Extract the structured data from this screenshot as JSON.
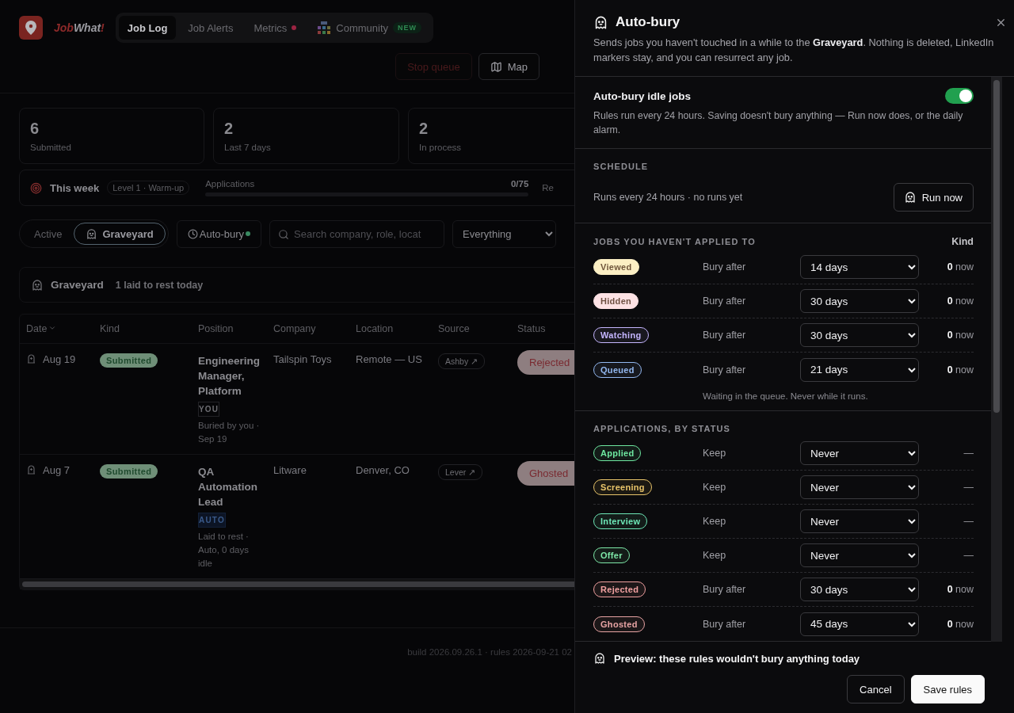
{
  "brand": {
    "parts": [
      {
        "text": "Job",
        "accent": true
      },
      {
        "text": "What",
        "accent": false
      },
      {
        "text": "!",
        "accent": true
      }
    ]
  },
  "nav_tabs": [
    {
      "label": "Job Log",
      "selected": true,
      "dot": false,
      "has_icon": false
    },
    {
      "label": "Job Alerts",
      "selected": false,
      "dot": false,
      "has_icon": false
    },
    {
      "label": "Metrics",
      "selected": false,
      "dot": true,
      "has_icon": false
    },
    {
      "label": "Community",
      "selected": false,
      "dot": false,
      "has_icon": true,
      "badge": "NEW"
    }
  ],
  "toolbar_buttons": [
    {
      "label": "Stop queue",
      "kind": "danger"
    },
    {
      "label": "Map",
      "kind": "map"
    }
  ],
  "stats": [
    {
      "value": "6",
      "label": "Submitted"
    },
    {
      "value": "2",
      "label": "Last 7 days"
    },
    {
      "value": "2",
      "label": "In process"
    }
  ],
  "week": {
    "title": "This week",
    "level_badge": "Level 1 · Warm-up",
    "meter": {
      "label": "Applications",
      "reading": "0/75",
      "level": 0
    },
    "next_label": "Re"
  },
  "filters": {
    "view_tabs": [
      {
        "label": "Active",
        "selected": false
      },
      {
        "label": "Graveyard",
        "selected": true
      }
    ],
    "autobury": {
      "label": "Auto-bury",
      "on": true
    },
    "search": {
      "placeholder": "Search company, role, locat"
    },
    "select": {
      "value": "Everything"
    }
  },
  "graveyard": {
    "title": "Graveyard",
    "subtitle": "1 laid to rest today"
  },
  "table": {
    "columns": [
      {
        "label": "Date",
        "sorted": true
      },
      {
        "label": "Kind",
        "sorted": false
      },
      {
        "label": "Position",
        "sorted": false
      },
      {
        "label": "Company",
        "sorted": false
      },
      {
        "label": "Location",
        "sorted": false
      },
      {
        "label": "Source",
        "sorted": false
      },
      {
        "label": "Status",
        "sorted": false
      }
    ],
    "rows": [
      {
        "date": "Aug 19",
        "kind": "Submitted",
        "position": "Engineering Manager, Platform",
        "tag": {
          "label": "YOU",
          "kind": "you"
        },
        "note": "Buried by you · Sep 19",
        "company": "Tailspin Toys",
        "location": "Remote — US",
        "source": "Ashby ↗",
        "status": "Rejected"
      },
      {
        "date": "Aug 7",
        "kind": "Submitted",
        "position": "QA Automation Lead",
        "tag": {
          "label": "AUTO",
          "kind": "auto"
        },
        "note": "Laid to rest · Auto, 0 days idle",
        "company": "Litware",
        "location": "Denver, CO",
        "source": "Lever ↗",
        "status": "Ghosted"
      }
    ]
  },
  "footer": "build 2026.09.26.1 · rules 2026-09-21 02",
  "drawer": {
    "title": "Auto-bury",
    "description": "Sends jobs you haven't touched in a while to the **Graveyard**. Nothing is deleted, LinkedIn markers stay, and you can resurrect any job.",
    "toggle": {
      "label": "Auto-bury idle jobs",
      "on": true,
      "hint": "Rules run every 24 hours. Saving doesn't bury anything — Run now does, or the daily alarm."
    },
    "schedule": {
      "heading": "SCHEDULE",
      "text": "Runs every 24 hours · no runs yet",
      "button": "Run now"
    },
    "sections": [
      {
        "heading": "JOBS YOU HAVEN'T APPLIED TO",
        "column": "Kind",
        "note": "Waiting in the queue. Never while it runs.",
        "rules": [
          {
            "label": "Viewed",
            "color": "#fcefc4",
            "fill": true,
            "action": "Bury after",
            "value": "14 days",
            "count": "**0** now"
          },
          {
            "label": "Hidden",
            "color": "#fde2e4",
            "fill": true,
            "action": "Bury after",
            "value": "30 days",
            "count": "**0** now"
          },
          {
            "label": "Watching",
            "color": "#c4b5fd",
            "fill": false,
            "action": "Bury after",
            "value": "30 days",
            "count": "**0** now"
          },
          {
            "label": "Queued",
            "color": "#93b8f0",
            "fill": false,
            "action": "Bury after",
            "value": "21 days",
            "count": "**0** now"
          }
        ]
      },
      {
        "heading": "APPLICATIONS, BY STATUS",
        "rules": [
          {
            "label": "Applied",
            "color": "#6ee7a0",
            "fill": false,
            "action": "Keep",
            "value": "Never",
            "count": "—"
          },
          {
            "label": "Screening",
            "color": "#e8c46a",
            "fill": false,
            "action": "Keep",
            "value": "Never",
            "count": "—"
          },
          {
            "label": "Interview",
            "color": "#6ee7b7",
            "fill": false,
            "action": "Keep",
            "value": "Never",
            "count": "—"
          },
          {
            "label": "Offer",
            "color": "#7ee8a8",
            "fill": false,
            "action": "Keep",
            "value": "Never",
            "count": "—"
          },
          {
            "label": "Rejected",
            "color": "#f0a0a0",
            "fill": false,
            "action": "Bury after",
            "value": "30 days",
            "count": "**0** now"
          },
          {
            "label": "Ghosted",
            "color": "#e8a4a4",
            "fill": false,
            "action": "Bury after",
            "value": "45 days",
            "count": "**0** now"
          }
        ]
      }
    ],
    "preview": "Preview: these rules wouldn't bury anything today",
    "buttons": [
      {
        "label": "Cancel",
        "kind": "secondary"
      },
      {
        "label": "Save rules",
        "kind": "primary"
      }
    ]
  }
}
